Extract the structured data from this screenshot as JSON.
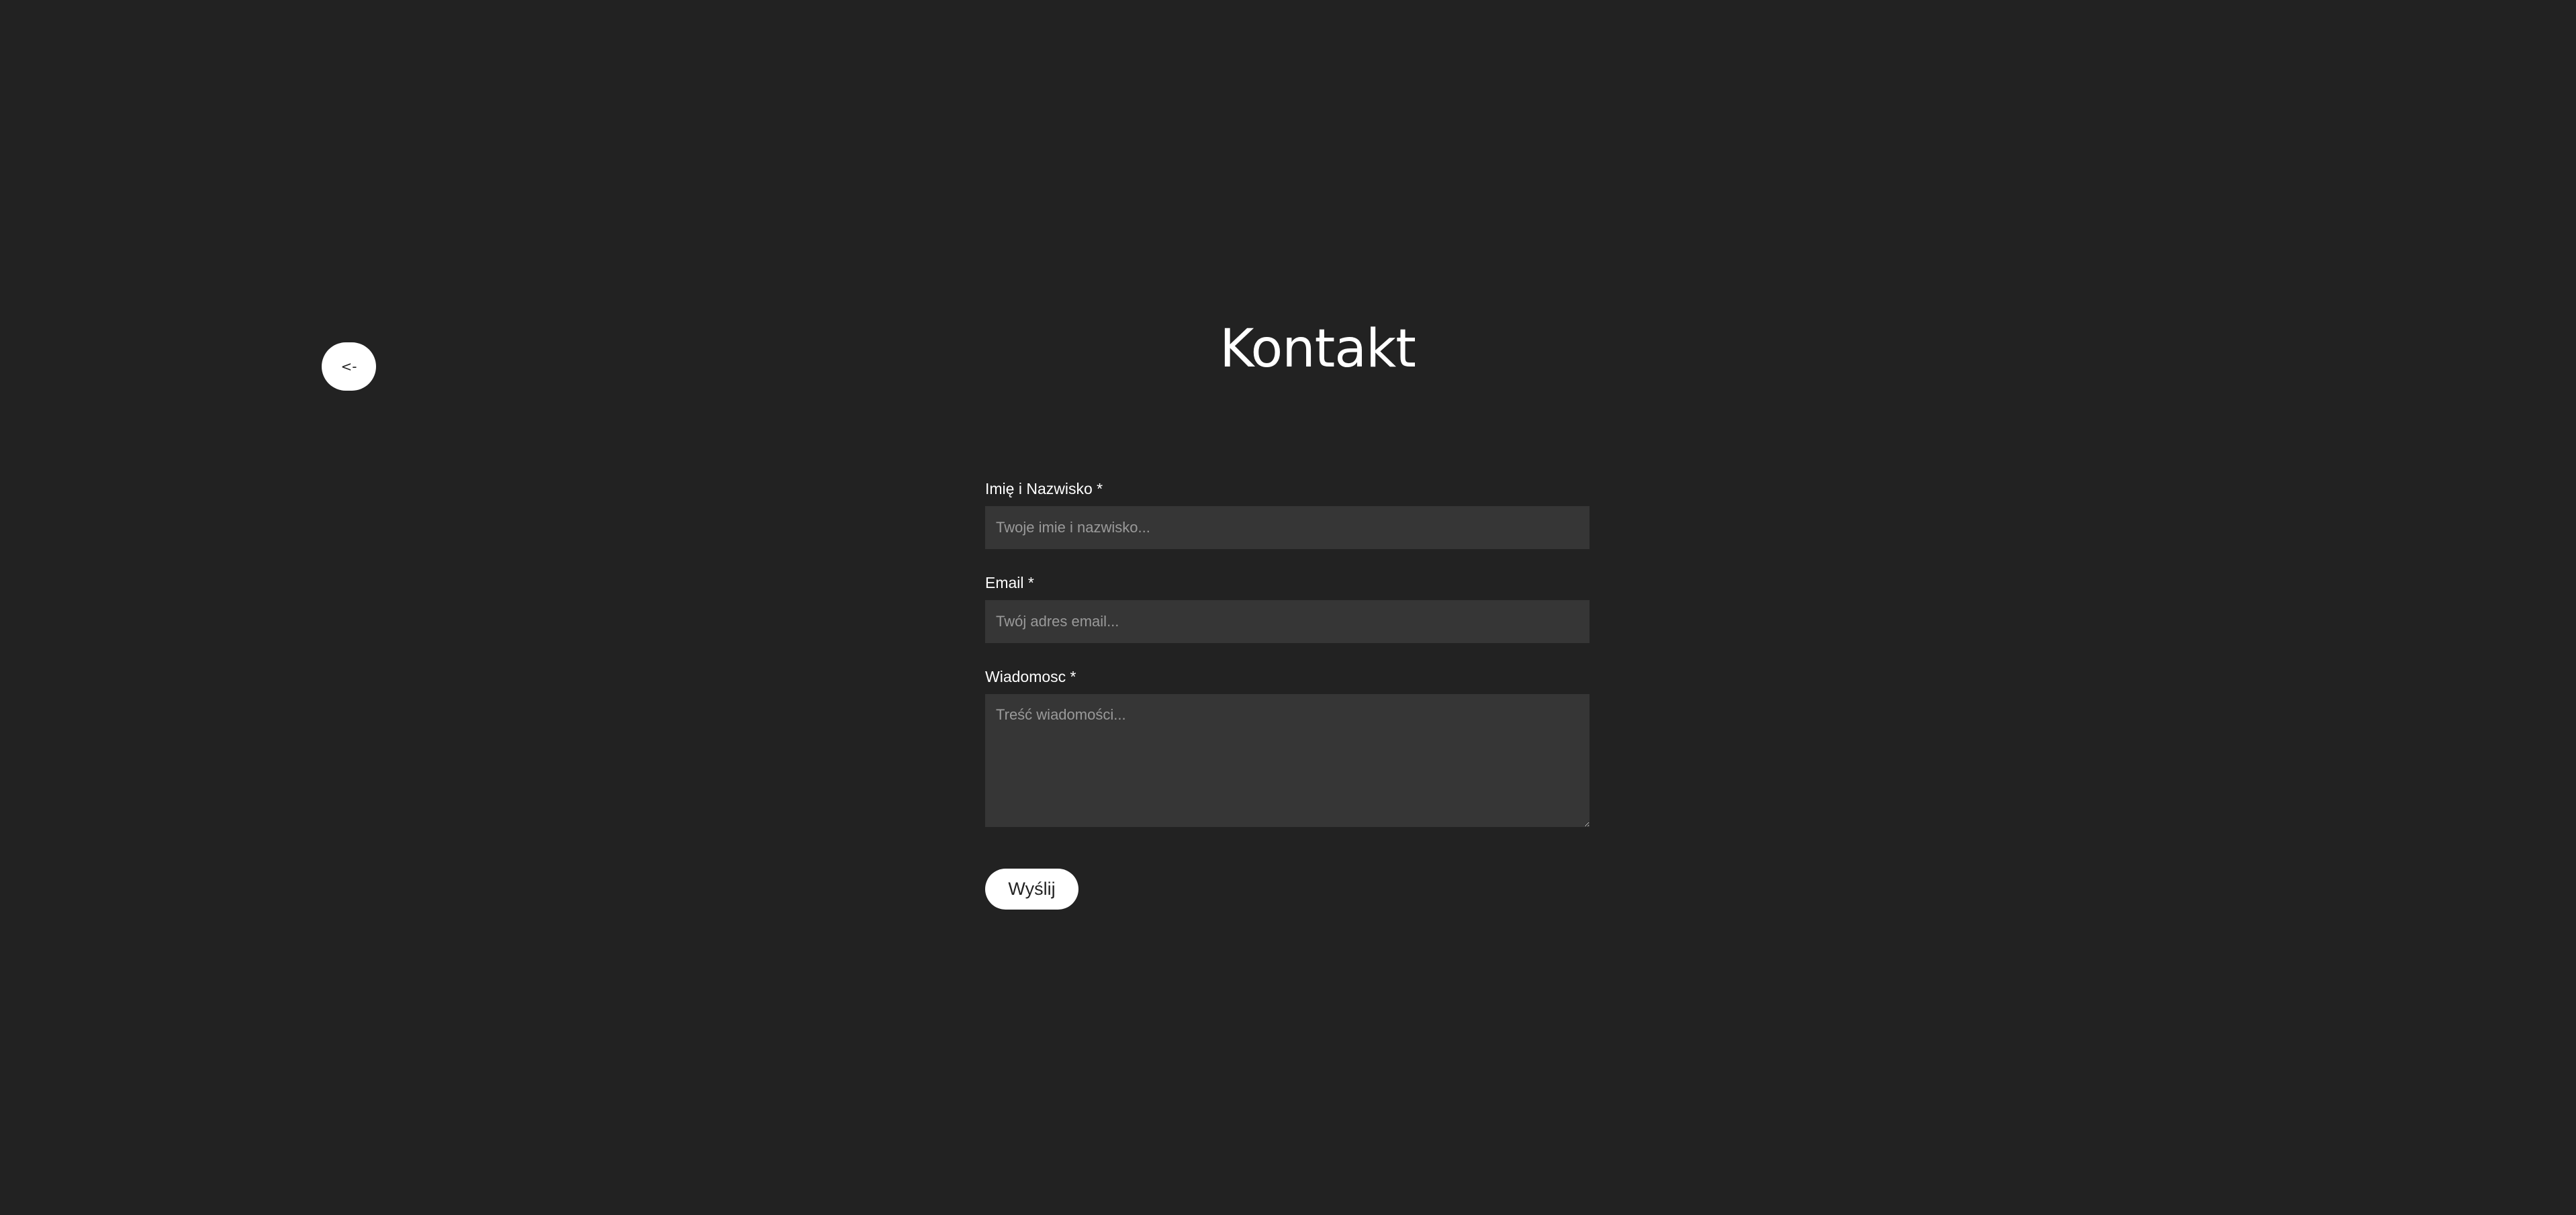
{
  "back_button": {
    "label": "<-"
  },
  "page": {
    "title": "Kontakt"
  },
  "form": {
    "name": {
      "label": "Imię i Nazwisko *",
      "placeholder": "Twoje imie i nazwisko...",
      "value": ""
    },
    "email": {
      "label": "Email *",
      "placeholder": "Twój adres email...",
      "value": ""
    },
    "message": {
      "label": "Wiadomosc *",
      "placeholder": "Treść wiadomości...",
      "value": ""
    },
    "submit_label": "Wyślij"
  },
  "colors": {
    "background": "#222222",
    "input_background": "#363636",
    "button_background": "#ffffff",
    "text": "#ffffff",
    "placeholder": "#9a9a9a"
  }
}
